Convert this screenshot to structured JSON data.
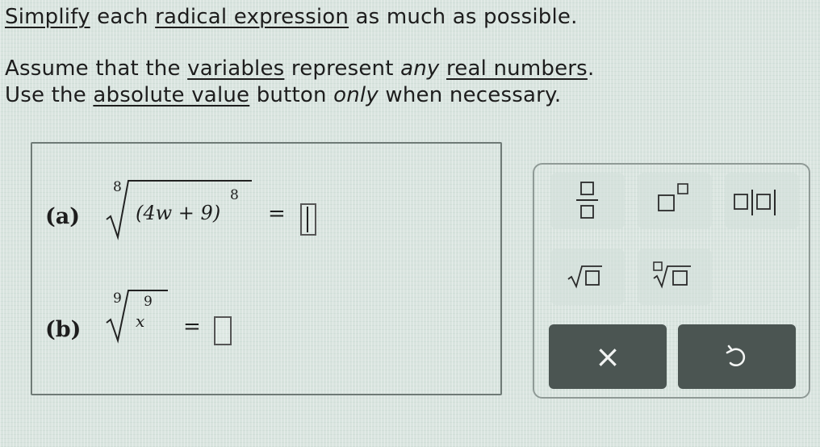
{
  "instructions": {
    "line1": [
      "Simplify",
      " each ",
      "radical expression",
      " as much as possible."
    ],
    "line2": [
      "Assume that the ",
      "variables",
      " represent ",
      "any",
      " ",
      "real numbers",
      "."
    ],
    "line3": [
      "Use the ",
      "absolute value",
      " button ",
      "only",
      " when necessary."
    ]
  },
  "problems": [
    {
      "label": "(a)",
      "index": "8",
      "base": "(4w + 9)",
      "exponent": "8",
      "equals": "="
    },
    {
      "label": "(b)",
      "index": "9",
      "base": "x",
      "exponent": "9",
      "equals": "="
    }
  ],
  "colors": {
    "text": "#1d1d1d",
    "action_button": "#4b5552",
    "action_glyph": "#f2f4f3"
  },
  "keypad": {
    "keys": [
      {
        "icon": "fraction-icon"
      },
      {
        "icon": "superscript-icon"
      },
      {
        "icon": "absolute-value-icon"
      },
      {
        "icon": "square-root-icon"
      },
      {
        "icon": "nth-root-icon"
      }
    ],
    "actions": [
      {
        "icon": "clear-icon",
        "glyph": "×"
      },
      {
        "icon": "undo-icon"
      }
    ]
  }
}
